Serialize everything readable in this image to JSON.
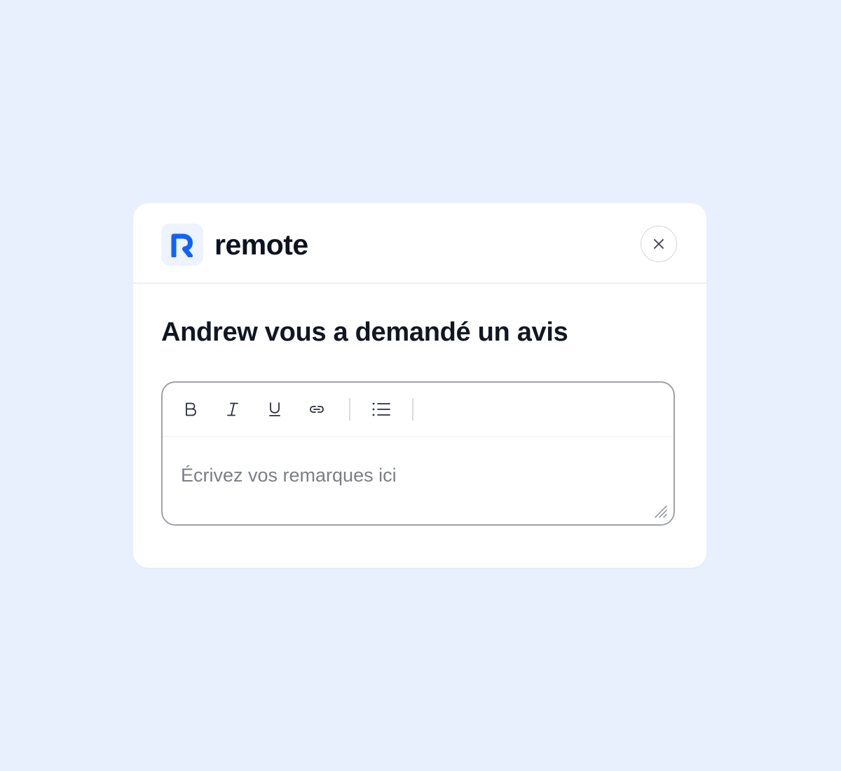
{
  "brand": {
    "name": "remote",
    "logo_letter": "R",
    "logo_color": "#0f62fe",
    "logo_bg": "#edf3ff"
  },
  "dialog": {
    "title": "Andrew vous a demandé un avis",
    "close_icon": "close-icon"
  },
  "editor": {
    "placeholder": "Écrivez vos remarques ici",
    "value": "",
    "toolbar": [
      {
        "name": "bold",
        "icon": "bold-icon"
      },
      {
        "name": "italic",
        "icon": "italic-icon"
      },
      {
        "name": "underline",
        "icon": "underline-icon"
      },
      {
        "name": "link",
        "icon": "link-icon"
      },
      {
        "name": "bullet-list",
        "icon": "bullet-list-icon"
      }
    ]
  },
  "colors": {
    "background": "#e8f0fd",
    "surface": "#ffffff",
    "text_primary": "#0c1220",
    "placeholder": "#7a7f87",
    "border": "#9fa3a9"
  }
}
